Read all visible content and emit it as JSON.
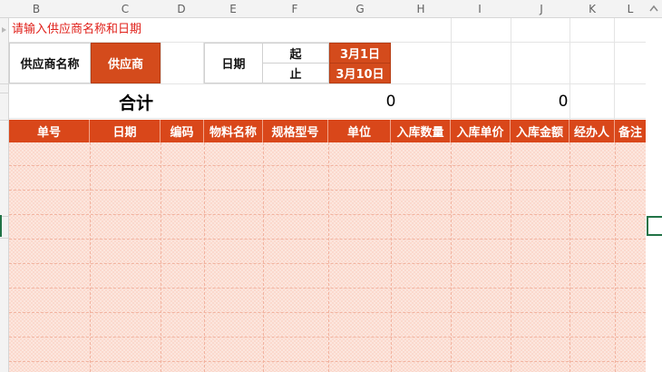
{
  "columns": [
    "B",
    "C",
    "D",
    "E",
    "F",
    "G",
    "H",
    "I",
    "J",
    "K",
    "L"
  ],
  "instruction": "请输入供应商名称和日期",
  "supplier": {
    "label": "供应商名称",
    "value": "供应商"
  },
  "date": {
    "label": "日期",
    "start_label": "起",
    "start_value": "3月1日",
    "end_label": "止",
    "end_value": "3月10日"
  },
  "totals": {
    "label": "合计",
    "quantity": "0",
    "amount": "0"
  },
  "table": {
    "headers": [
      "单号",
      "日期",
      "编码",
      "物料名称",
      "规格型号",
      "单位",
      "入库数量",
      "入库单价",
      "入库金额",
      "经办人",
      "备注"
    ]
  },
  "colors": {
    "header_orange": "#d9471a",
    "box_orange": "#d44b1c",
    "row_fill": "#fbd9cd",
    "instruction_red": "#e0201a",
    "selection_green": "#217346"
  }
}
